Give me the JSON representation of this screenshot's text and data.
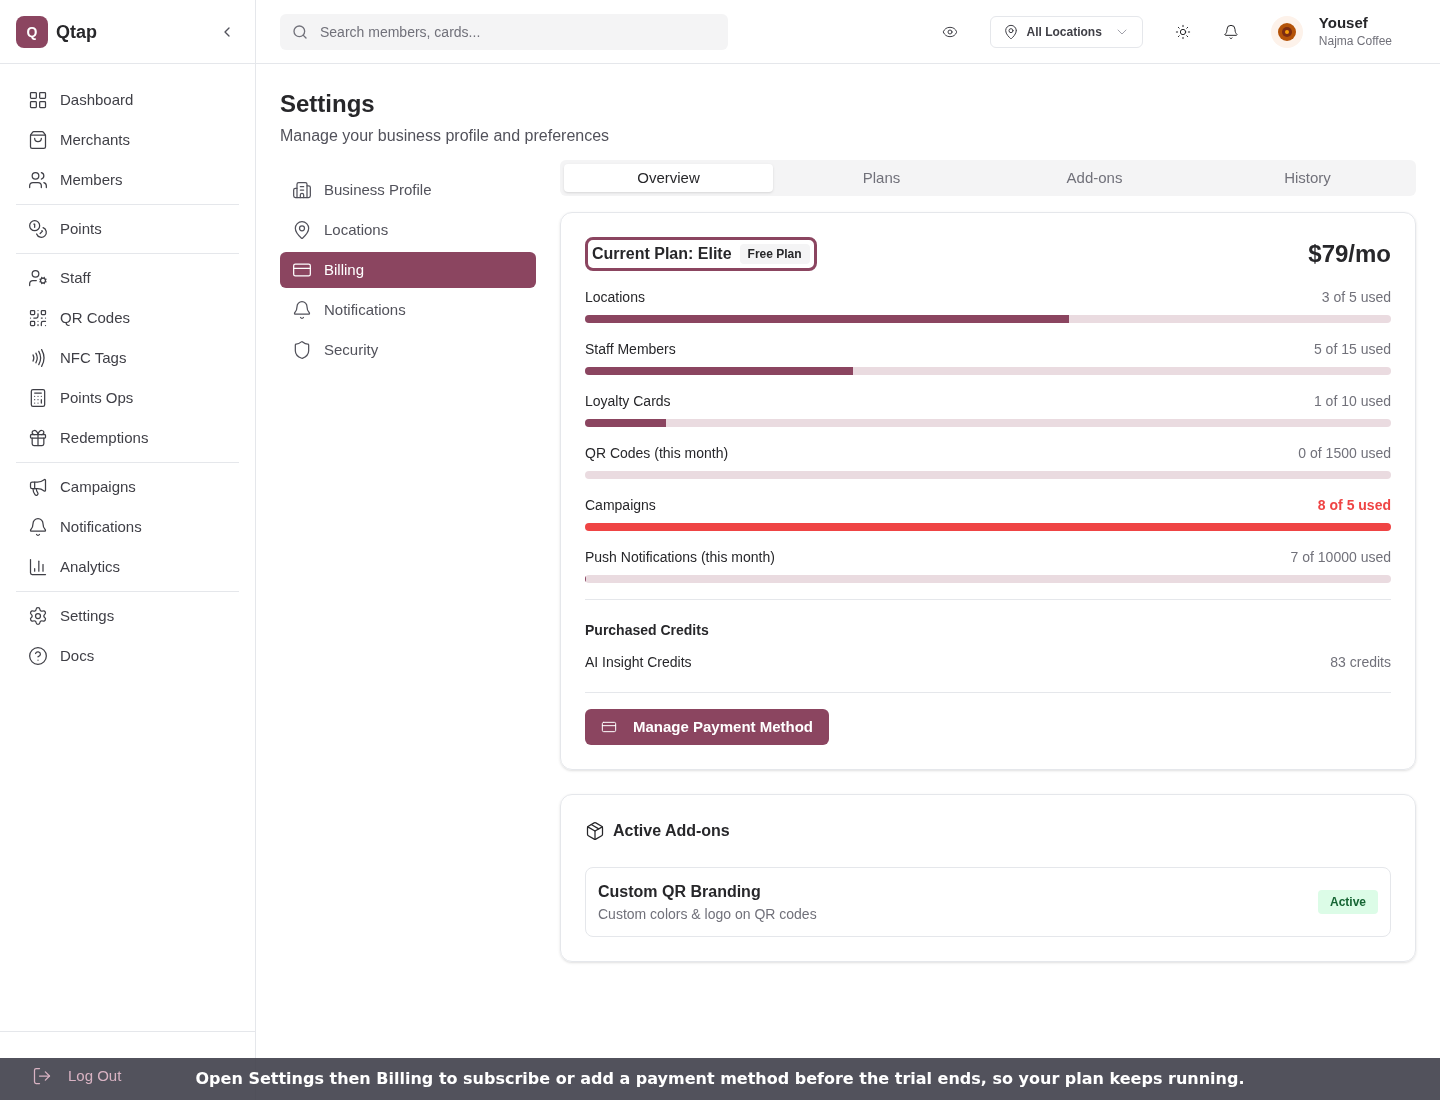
{
  "brand": {
    "logo_letter": "Q",
    "name": "Qtap"
  },
  "sidebar": {
    "groups": [
      {
        "items": [
          {
            "label": "Dashboard"
          },
          {
            "label": "Merchants"
          },
          {
            "label": "Members"
          }
        ]
      },
      {
        "items": [
          {
            "label": "Points"
          }
        ]
      },
      {
        "items": [
          {
            "label": "Staff"
          },
          {
            "label": "QR Codes"
          },
          {
            "label": "NFC Tags"
          },
          {
            "label": "Points Ops"
          },
          {
            "label": "Redemptions"
          }
        ]
      },
      {
        "items": [
          {
            "label": "Campaigns"
          },
          {
            "label": "Notifications"
          },
          {
            "label": "Analytics"
          }
        ]
      },
      {
        "items": [
          {
            "label": "Settings"
          },
          {
            "label": "Docs"
          }
        ]
      }
    ],
    "logout": "Log Out"
  },
  "header": {
    "search_placeholder": "Search members, cards...",
    "location": "All Locations",
    "user": {
      "name": "Yousef",
      "business": "Najma Coffee"
    }
  },
  "page": {
    "title": "Settings",
    "subtitle": "Manage your business profile and preferences"
  },
  "settings_nav": [
    {
      "label": "Business Profile",
      "selected": false
    },
    {
      "label": "Locations",
      "selected": false
    },
    {
      "label": "Billing",
      "selected": true
    },
    {
      "label": "Notifications",
      "selected": false
    },
    {
      "label": "Security",
      "selected": false
    }
  ],
  "tabs": [
    {
      "label": "Overview",
      "selected": true
    },
    {
      "label": "Plans",
      "selected": false
    },
    {
      "label": "Add-ons",
      "selected": false
    },
    {
      "label": "History",
      "selected": false
    }
  ],
  "plan": {
    "title": "Current Plan: Elite",
    "badge": "Free Plan",
    "price": "$79/mo",
    "usage": [
      {
        "name": "Locations",
        "reading": "3 of 5 used",
        "level": 0.6,
        "over_limit": false
      },
      {
        "name": "Staff Members",
        "reading": "5 of 15 used",
        "level": 0.333,
        "over_limit": false
      },
      {
        "name": "Loyalty Cards",
        "reading": "1 of 10 used",
        "level": 0.1,
        "over_limit": false
      },
      {
        "name": "QR Codes (this month)",
        "reading": "0 of 1500 used",
        "level": 0,
        "over_limit": false
      },
      {
        "name": "Campaigns",
        "reading": "8 of 5 used",
        "level": 1,
        "over_limit": true
      },
      {
        "name": "Push Notifications (this month)",
        "reading": "7 of 10000 used",
        "level": 0.0007,
        "over_limit": false
      }
    ],
    "credits_title": "Purchased Credits",
    "credits": [
      {
        "name": "AI Insight Credits",
        "value": "83 credits"
      }
    ],
    "button": "Manage Payment Method"
  },
  "addons": {
    "title": "Active Add-ons",
    "items": [
      {
        "name": "Custom QR Branding",
        "description": "Custom colors & logo on QR codes",
        "status": "Active"
      }
    ]
  },
  "banner": "Open Settings then Billing to subscribe or add a payment method before the trial ends, so your plan keeps running."
}
